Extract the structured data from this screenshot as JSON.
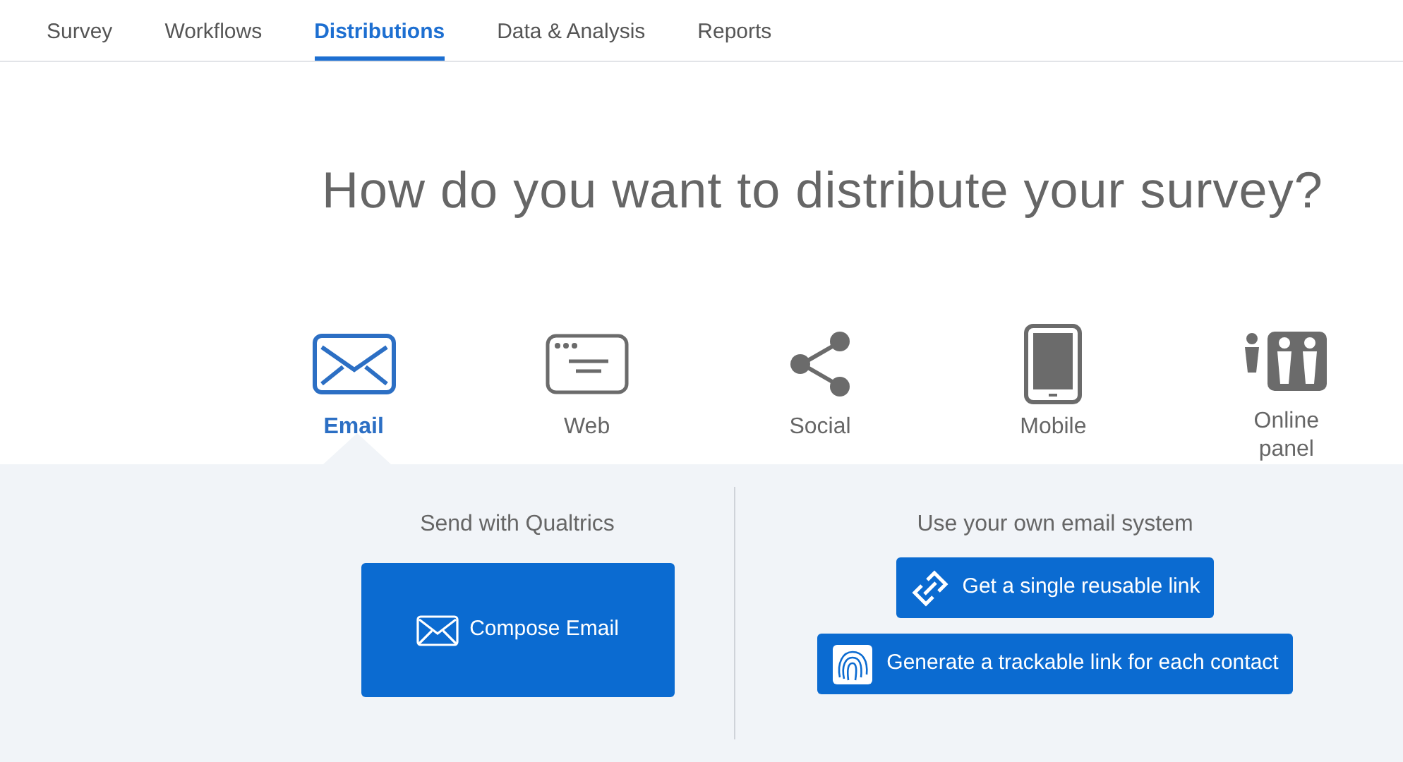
{
  "tabs": [
    {
      "label": "Survey",
      "selected": false
    },
    {
      "label": "Workflows",
      "selected": false
    },
    {
      "label": "Distributions",
      "selected": true
    },
    {
      "label": "Data & Analysis",
      "selected": false
    },
    {
      "label": "Reports",
      "selected": false
    }
  ],
  "heading": "How do you want to distribute your survey?",
  "options": [
    {
      "kind": "email",
      "label": "Email",
      "selected": true
    },
    {
      "kind": "web",
      "label": "Web",
      "selected": false
    },
    {
      "kind": "social",
      "label": "Social",
      "selected": false
    },
    {
      "kind": "mobile",
      "label": "Mobile",
      "selected": false
    },
    {
      "kind": "panel",
      "label": "Online panel",
      "selected": false
    }
  ],
  "panel": {
    "left": {
      "title": "Send with Qualtrics",
      "button": "Compose Email"
    },
    "right": {
      "title": "Use your own email system",
      "buttons": [
        {
          "kind": "link",
          "label": "Get a single reusable link"
        },
        {
          "kind": "fingerprint",
          "label": "Generate a trackable link for each contact"
        }
      ]
    }
  }
}
